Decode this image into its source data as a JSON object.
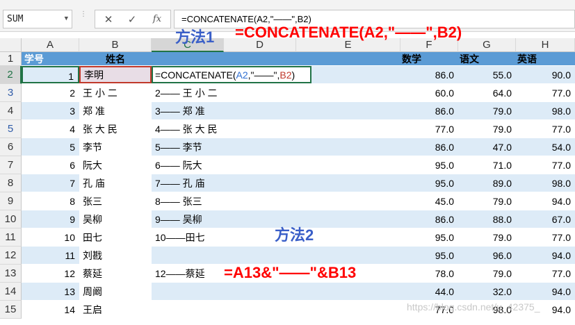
{
  "formula_bar": {
    "name_box": "SUM",
    "cancel_icon": "✕",
    "enter_icon": "✓",
    "fx_icon": "fx",
    "formula": "=CONCATENATE(A2,\"——\",B2)"
  },
  "columns": [
    "A",
    "B",
    "C",
    "D",
    "E",
    "F",
    "G",
    "H"
  ],
  "header_row": {
    "row_no": "1",
    "a": "学号",
    "b": "姓名",
    "f": "数学",
    "g": "语文",
    "h": "英语"
  },
  "rows": [
    {
      "no": "2",
      "a": "1",
      "b": "李明",
      "c": "",
      "f": "86.0",
      "g": "55.0",
      "h": "90.0"
    },
    {
      "no": "3",
      "a": "2",
      "b": "王 小 二",
      "c": "2—— 王 小 二",
      "f": "60.0",
      "g": "64.0",
      "h": "77.0"
    },
    {
      "no": "4",
      "a": "3",
      "b": "郑 准",
      "c": "3—— 郑 准",
      "f": "86.0",
      "g": "79.0",
      "h": "98.0"
    },
    {
      "no": "5",
      "a": "4",
      "b": "张 大 民",
      "c": "4—— 张 大 民",
      "f": "77.0",
      "g": "79.0",
      "h": "77.0"
    },
    {
      "no": "6",
      "a": "5",
      "b": "李节",
      "c": "5—— 李节",
      "f": "86.0",
      "g": "47.0",
      "h": "54.0"
    },
    {
      "no": "7",
      "a": "6",
      "b": "阮大",
      "c": "6—— 阮大",
      "f": "95.0",
      "g": "71.0",
      "h": "77.0"
    },
    {
      "no": "8",
      "a": "7",
      "b": "孔 庙",
      "c": "7—— 孔 庙",
      "f": "95.0",
      "g": "89.0",
      "h": "98.0"
    },
    {
      "no": "9",
      "a": "8",
      "b": "张三",
      "c": "8—— 张三",
      "f": "45.0",
      "g": "79.0",
      "h": "94.0"
    },
    {
      "no": "10",
      "a": "9",
      "b": "吴柳",
      "c": "9—— 吴柳",
      "f": "86.0",
      "g": "88.0",
      "h": "67.0"
    },
    {
      "no": "11",
      "a": "10",
      "b": "田七",
      "c": "10——田七",
      "f": "95.0",
      "g": "79.0",
      "h": "77.0"
    },
    {
      "no": "12",
      "a": "11",
      "b": "刘戡",
      "c": "",
      "f": "95.0",
      "g": "96.0",
      "h": "94.0"
    },
    {
      "no": "13",
      "a": "12",
      "b": "蔡延",
      "c": "12——蔡延",
      "f": "78.0",
      "g": "79.0",
      "h": "77.0"
    },
    {
      "no": "14",
      "a": "13",
      "b": "周阚",
      "c": "",
      "f": "44.0",
      "g": "32.0",
      "h": "94.0"
    },
    {
      "no": "15",
      "a": "14",
      "b": "王启",
      "c": "",
      "f": "77.0",
      "g": "98.0",
      "h": "94.0"
    }
  ],
  "editing_cell": {
    "prefix": "=CONCATENATE(",
    "ref1": "A2",
    "middle": ",\"——\",",
    "ref2": "B2",
    "suffix": ")"
  },
  "annotations": {
    "method1_label": "方法1",
    "method1_formula": "=CONCATENATE(A2,\"——\",B2)",
    "method2_label": "方法2",
    "method2_formula": "=A13&\"——\"&B13"
  },
  "watermark": "https://blog.csdn.net/u_42375_",
  "colors": {
    "header_fill": "#5b9bd5",
    "band_fill": "#ddebf7",
    "method_label": "#3a5fc8",
    "method_formula": "#ff0000",
    "ref_blue": "#2f6fd2",
    "ref_red": "#c0392b"
  }
}
